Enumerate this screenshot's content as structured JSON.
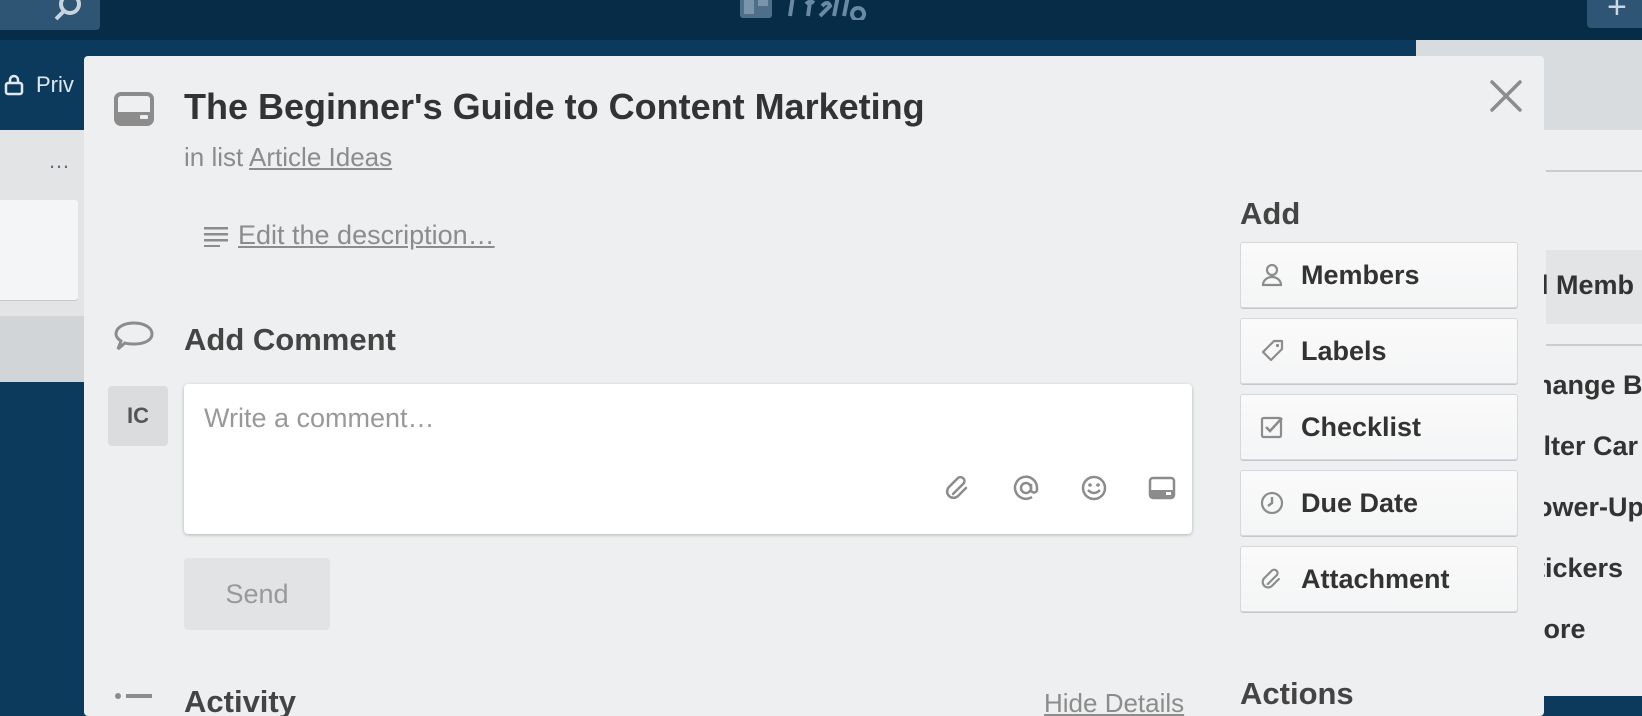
{
  "card": {
    "title": "The Beginner's Guide to Content Marketing",
    "in_list_prefix": "in list",
    "list_name": "Article Ideas",
    "description_link": "Edit the description…"
  },
  "comment": {
    "heading": "Add Comment",
    "avatar_initials": "IC",
    "placeholder": "Write a comment…",
    "tools": [
      "attachment-icon",
      "mention-icon",
      "emoji-icon",
      "card-icon"
    ],
    "send_label": "Send"
  },
  "activity": {
    "heading": "Activity",
    "hide_details": "Hide Details"
  },
  "sidebar": {
    "add_heading": "Add",
    "buttons": [
      {
        "label": "Members",
        "icon": "member-icon"
      },
      {
        "label": "Labels",
        "icon": "label-icon"
      },
      {
        "label": "Checklist",
        "icon": "checklist-icon"
      },
      {
        "label": "Due Date",
        "icon": "clock-icon"
      },
      {
        "label": "Attachment",
        "icon": "attachment-icon"
      }
    ],
    "actions_heading": "Actions"
  },
  "background": {
    "privacy_text": "Priv",
    "add_member_text": "d Memb",
    "menu_items": [
      "hange B",
      "ilter Car",
      "ower-Up",
      "tickers",
      "lore"
    ]
  },
  "colors": {
    "board_bg": "#0b3a5c",
    "topbar_bg": "#062c48",
    "modal_bg": "#edeff0",
    "text_dark": "#333333",
    "text_muted": "#8c8c8c"
  }
}
